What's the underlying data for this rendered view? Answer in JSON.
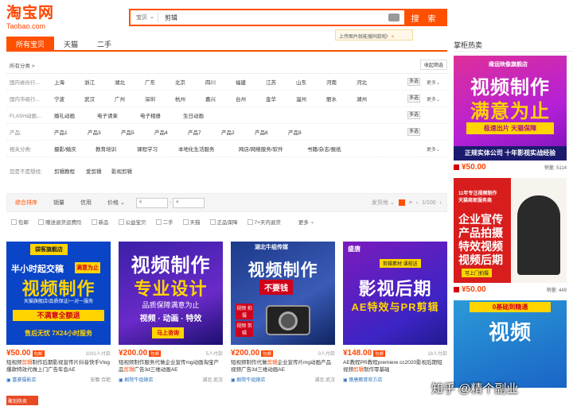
{
  "logo": {
    "main": "淘宝网",
    "sub": "Taobao.com"
  },
  "search": {
    "category": "宝贝",
    "query": "剪辑",
    "button": "搜 索"
  },
  "tip": {
    "text": "上传图片就能搜同款啦!",
    "close": "×"
  },
  "tabs": [
    "所有宝贝",
    "天猫",
    "二手"
  ],
  "filter": {
    "all_cat": "所有分类 >",
    "collapse": "收起筛选",
    "rows": [
      {
        "label": "国内省份行...",
        "values": [
          "上海",
          "浙江",
          "湖北",
          "广东",
          "北京",
          "四川",
          "福建",
          "江苏",
          "山东",
          "河南",
          "河北"
        ],
        "multi": "多选",
        "more": "更多"
      },
      {
        "label": "国内市级行...",
        "values": [
          "宁波",
          "武汉",
          "广州",
          "深圳",
          "杭州",
          "嘉兴",
          "台州",
          "金华",
          "温州",
          "丽水",
          "湖州"
        ],
        "multi": "多选",
        "more": "更多"
      },
      {
        "label": "FLASH动画...",
        "values": [
          "婚礼动画",
          "电子请柬",
          "电子相册",
          "生日动画"
        ],
        "multi": "多选",
        "more": ""
      },
      {
        "label": "产品:",
        "values": [
          "产品1",
          "产品3",
          "产品5",
          "产品4",
          "产品7",
          "产品2",
          "产品6",
          "产品9"
        ],
        "multi": "多选",
        "more": ""
      },
      {
        "label": "相关分类:",
        "values": [
          "摄影/婚庆",
          "教育培训",
          "课程学习",
          "本地化生活服务",
          "网店/网络服务/软件",
          "书籍/杂志/报纸"
        ],
        "multi": "",
        "more": "更多"
      }
    ],
    "guess_label": "您是不是想找:",
    "guess": [
      "剪辑教程",
      "爱剪辑",
      "影视剪辑"
    ]
  },
  "sort": {
    "items": [
      "综合排序",
      "销量",
      "信用",
      "价格"
    ],
    "price_ph": "¥",
    "ship_from": "发货地",
    "page": "1/100"
  },
  "opts": [
    "包邮",
    "赠送退货运费险",
    "新品",
    "公益宝贝",
    "二手",
    "天猫",
    "正品保障",
    "7+天内退货",
    "更多"
  ],
  "items": [
    {
      "price": "¥50.00",
      "ship": "包邮",
      "count": "1091人付款",
      "desc_pre": "短视频",
      "desc_hl": "剪辑",
      "desc_post": "制作后期影视宣传片抖音快手Vlog爆款特效代做上门广告年会AE",
      "shop": "富豪摄影店",
      "loc": "安徽 合肥",
      "img": {
        "tag": "袋客旗舰店",
        "l1": "半小时起交稿",
        "badge": "满意为止",
        "l2": "视频制作",
        "l3": "天猫旗舰店/品质保证/一对一服务",
        "band": "不满意全额退",
        "foot": "售后无忧 7X24小时服务"
      }
    },
    {
      "price": "¥200.00",
      "ship": "包邮",
      "count": "5人付款",
      "desc_pre": "短视频制作服务代做企业宣传mg动画淘宝产品",
      "desc_hl": "剪辑",
      "desc_post": "广告3d三维动画AE",
      "shop": "剧院牛组娘店",
      "loc": "湖北 武汉",
      "img": {
        "l1": "视频制作",
        "l2": "专业设计",
        "l3": "品质保障满意为止",
        "l4": "视频 · 动画 · 特效",
        "btn": "马上咨询"
      }
    },
    {
      "price": "¥200.00",
      "ship": "包邮",
      "count": "0人付款",
      "desc_pre": "短视频制作代做",
      "desc_hl": "剪辑",
      "desc_post": "企业宣传片mg动画产品视频广告3d三维动画AE",
      "shop": "剧院牛组娘店",
      "loc": "湖北 武汉",
      "img": {
        "tag": "湖北牛组传媒",
        "l1": "视频制作",
        "l2": "不要钱",
        "side": "视频 拍摄",
        "side2": "视频 剪辑"
      }
    },
    {
      "price": "¥148.00",
      "ship": "包邮",
      "count": "18人付款",
      "desc_pre": "AE教程PR教程premiere cc2020影视后期短视频",
      "desc_hl": "剪辑",
      "desc_post": "制作零基础",
      "shop": "傲唐教育官方店",
      "loc": "",
      "img": {
        "tag": "盛唐",
        "sub": "剪辑素材 课程送",
        "l1": "影视后期",
        "l2": "AE特效与PR剪辑"
      }
    }
  ],
  "side": {
    "title": "掌柜热卖",
    "ads": [
      {
        "img": {
          "tag": "缘运映像旗舰店",
          "l1": "视频制作",
          "l2": "满意为止",
          "l3": "极速出片 天猫保障",
          "foot": "正规实体公司 十年影视实战经验"
        },
        "price": "¥50.00",
        "count": "销量: 5114"
      },
      {
        "img": {
          "top": "11年专注视频制作",
          "top2": "天猫商家服务商",
          "l1": "企业宣传",
          "l2": "产品拍摄",
          "l3": "特效视频",
          "l4": "视频后期",
          "btn": "可上门拍摄"
        },
        "price": "¥50.00",
        "count": "销量: 449"
      },
      {
        "img": {
          "top": "0基础到精通",
          "l1": "视频"
        }
      }
    ]
  },
  "watermark": "知乎 @精个副业",
  "qing": "聚划热卖"
}
